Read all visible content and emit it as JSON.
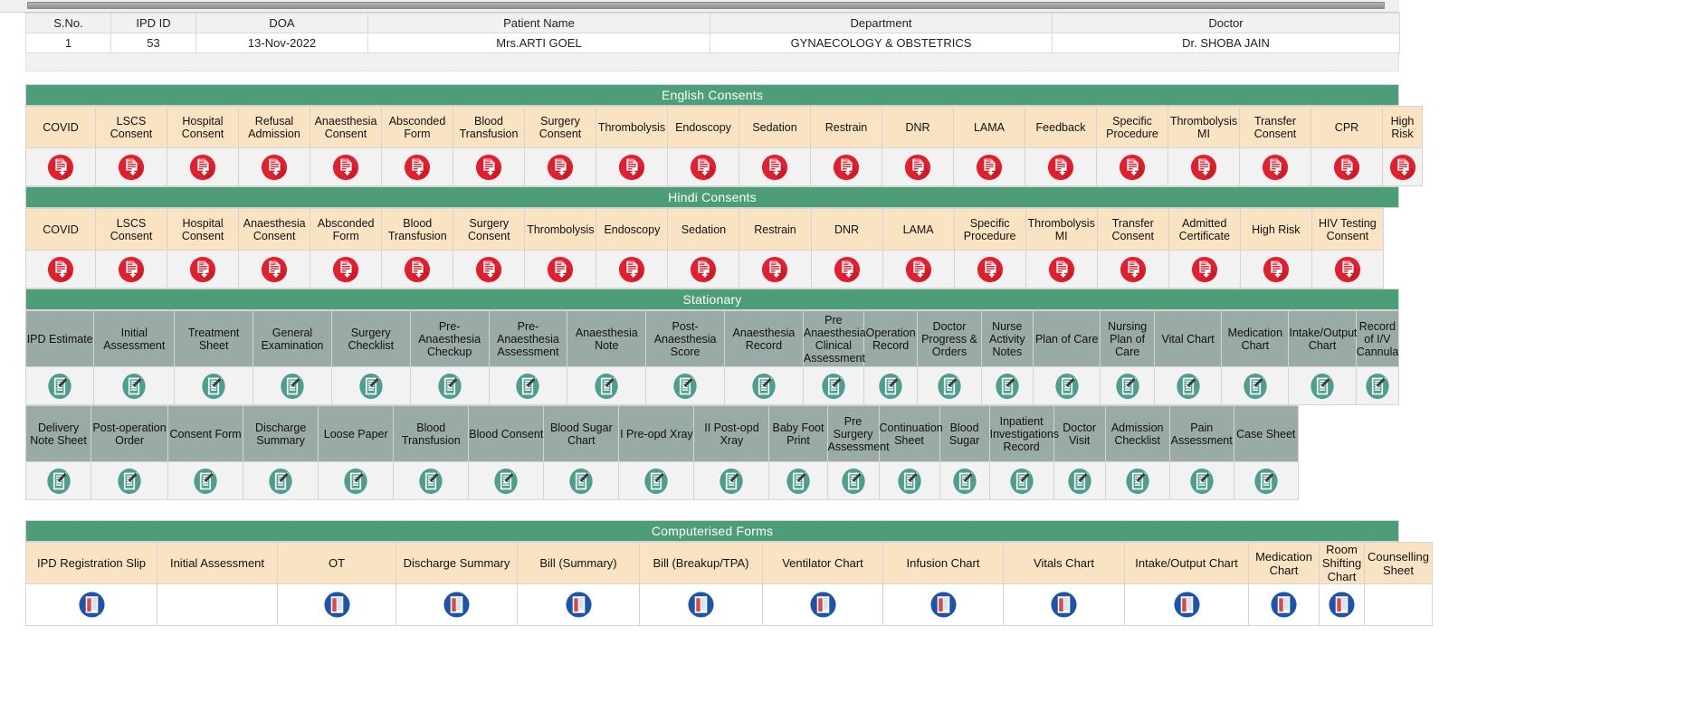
{
  "patient_table": {
    "columns": [
      "S.No.",
      "IPD ID",
      "DOA",
      "Patient Name",
      "Department",
      "Doctor"
    ],
    "rows": [
      {
        "sno": "1",
        "ipd_id": "53",
        "doa": "13-Nov-2022",
        "patient_name": "Mrs.ARTI GOEL",
        "department": "GYNAECOLOGY & OBSTETRICS",
        "doctor": "Dr. SHOBA JAIN"
      }
    ]
  },
  "sections": {
    "english_consents": {
      "title": "English Consents",
      "icon": "pdf-download-icon",
      "items": [
        "COVID",
        "LSCS Consent",
        "Hospital Consent",
        "Refusal Admission",
        "Anaesthesia Consent",
        "Absconded Form",
        "Blood Transfusion",
        "Surgery Consent",
        "Thrombolysis",
        "Endoscopy",
        "Sedation",
        "Restrain",
        "DNR",
        "LAMA",
        "Feedback",
        "Specific Procedure",
        "Thrombolysis MI",
        "Transfer Consent",
        "CPR",
        "High Risk"
      ]
    },
    "hindi_consents": {
      "title": "Hindi Consents",
      "icon": "pdf-download-icon",
      "items": [
        "COVID",
        "LSCS Consent",
        "Hospital Consent",
        "Anaesthesia Consent",
        "Absconded Form",
        "Blood Transfusion",
        "Surgery Consent",
        "Thrombolysis",
        "Endoscopy",
        "Sedation",
        "Restrain",
        "DNR",
        "LAMA",
        "Specific Procedure",
        "Thrombolysis MI",
        "Transfer Consent",
        "Admitted Certificate",
        "High Risk",
        "HIV Testing Consent"
      ]
    },
    "stationary": {
      "title": "Stationary",
      "icon": "document-pen-icon",
      "row1": [
        "IPD Estimate",
        "Initial Assessment",
        "Treatment Sheet",
        "General Examination",
        "Surgery Checklist",
        "Pre-Anaesthesia Checkup",
        "Pre-Anaesthesia Assessment",
        "Anaesthesia Note",
        "Post-Anaesthesia Score",
        "Anaesthesia Record",
        "Pre Anaesthesia Clinical Assessment",
        "Operation Record",
        "Doctor Progress & Orders",
        "Nurse Activity Notes",
        "Plan of Care",
        "Nursing Plan of Care",
        "Vital Chart",
        "Medication Chart",
        "Intake/Output Chart",
        "Record of I/V Cannula"
      ],
      "row2": [
        "Delivery Note Sheet",
        "Post-operation Order",
        "Consent Form",
        "Discharge Summary",
        "Loose Paper",
        "Blood Transfusion",
        "Blood Consent",
        "Blood Sugar Chart",
        "I Pre-opd Xray",
        "II Post-opd Xray",
        "Baby Foot Print",
        "Pre Surgery Assessment",
        "Continuation Sheet",
        "Blood Sugar",
        "Inpatient Investigations Record",
        "Doctor Visit",
        "Admission Checklist",
        "Pain Assessment",
        "Case Sheet"
      ]
    },
    "computerised_forms": {
      "title": "Computerised Forms",
      "icon": "blue-document-icon",
      "items": [
        "IPD Registration Slip",
        "Initial Assessment",
        "OT",
        "Discharge Summary",
        "Bill (Summary)",
        "Bill (Breakup/TPA)",
        "Ventilator Chart",
        "Infusion Chart",
        "Vitals Chart",
        "Intake/Output Chart",
        "Medication Chart",
        "Room Shifting Chart",
        "Counselling Sheet"
      ],
      "icon_present": [
        true,
        false,
        true,
        true,
        true,
        true,
        true,
        true,
        true,
        true,
        true,
        true,
        false
      ]
    }
  },
  "colors": {
    "banner_green": "#4d9e78",
    "consent_header_beige": "#fae3c2",
    "stationary_header_gray": "#9aaaa6",
    "pdf_icon_red": "#e1202f",
    "stationary_icon_green": "#4d9e8e",
    "computer_icon_blue": "#1b54a8"
  }
}
